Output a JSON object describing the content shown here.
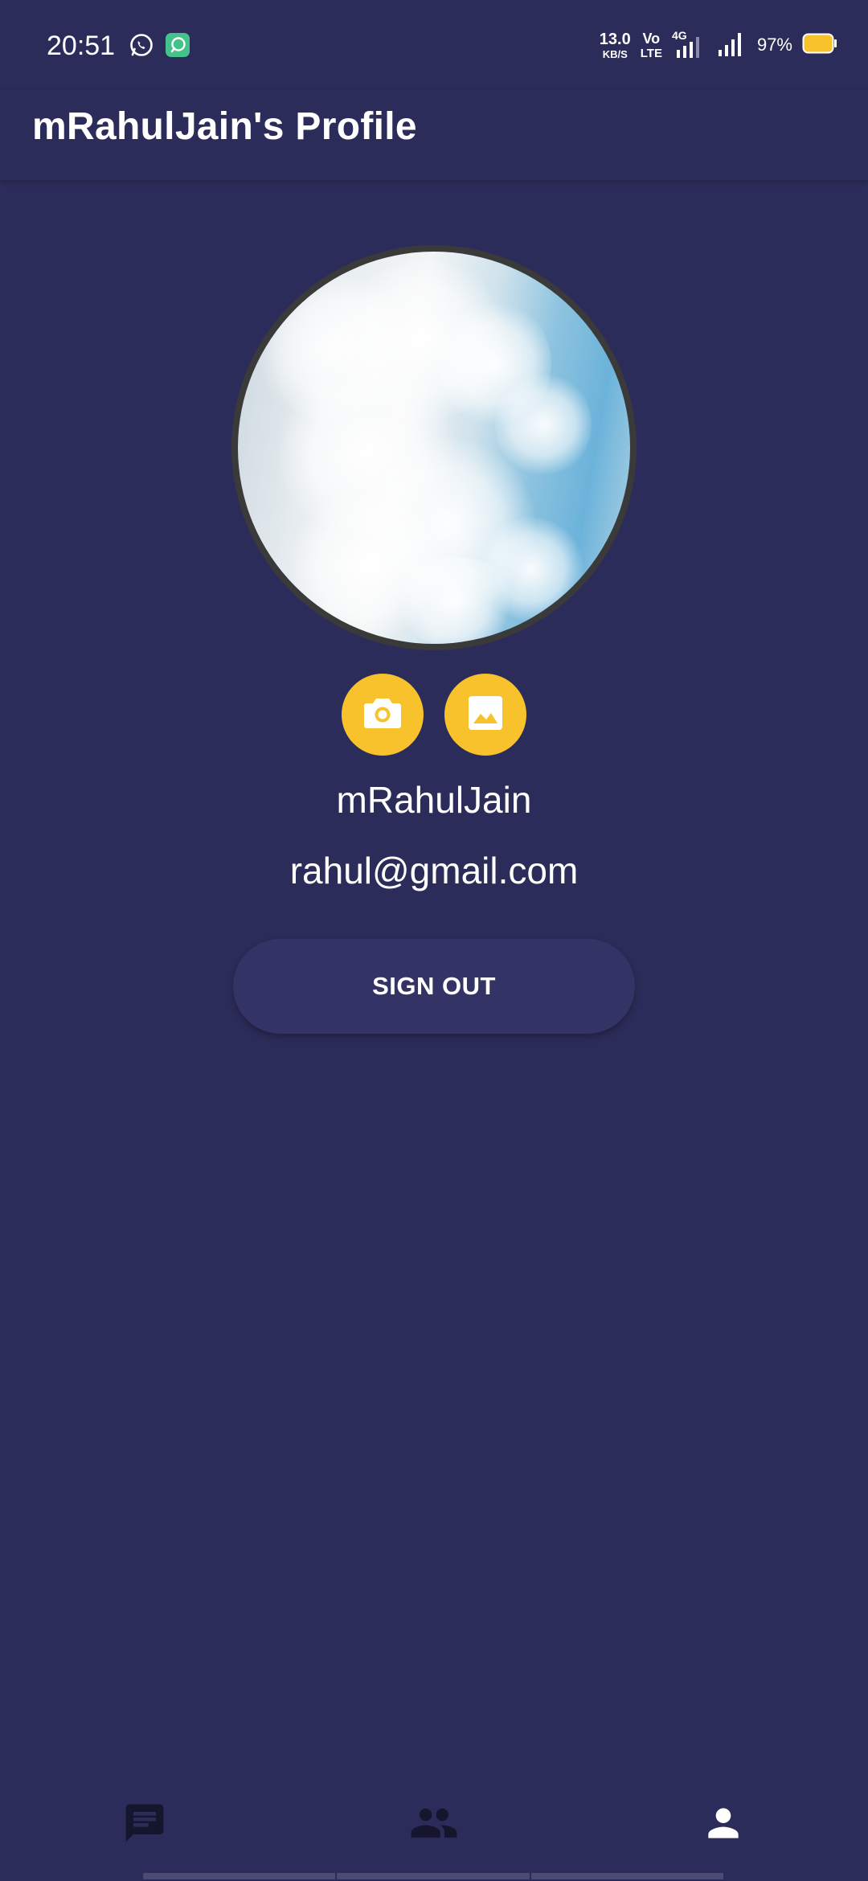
{
  "status_bar": {
    "time": "20:51",
    "net_speed_value": "13.0",
    "net_speed_unit": "KB/S",
    "volte_top": "Vo",
    "volte_bottom": "LTE",
    "network_type": "4G",
    "battery": "97%",
    "battery_color": "#f7c22b",
    "icons": [
      "whatsapp-icon",
      "chat-app-icon",
      "signal-icon",
      "battery-icon"
    ]
  },
  "app_bar": {
    "title": "mRahulJain's Profile"
  },
  "profile": {
    "username": "mRahulJain",
    "email": "rahul@gmail.com",
    "actions": [
      {
        "icon": "camera-icon"
      },
      {
        "icon": "gallery-icon"
      }
    ],
    "signout_label": "SIGN OUT"
  },
  "bottom_nav": {
    "items": [
      {
        "icon": "chat-icon"
      },
      {
        "icon": "people-icon"
      },
      {
        "icon": "person-icon"
      }
    ],
    "active_index": 2
  },
  "colors": {
    "background": "#2c2c5a",
    "accent": "#f7c22b",
    "button": "#333366",
    "inactive_icon": "#15152e",
    "active_icon": "#ffffff"
  }
}
